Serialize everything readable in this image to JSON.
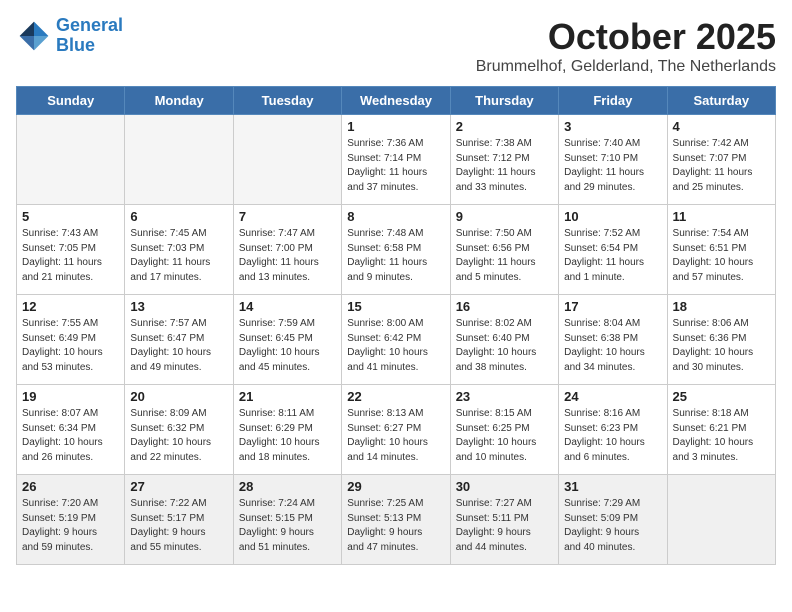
{
  "header": {
    "logo_line1": "General",
    "logo_line2": "Blue",
    "month_year": "October 2025",
    "location": "Brummelhof, Gelderland, The Netherlands"
  },
  "weekdays": [
    "Sunday",
    "Monday",
    "Tuesday",
    "Wednesday",
    "Thursday",
    "Friday",
    "Saturday"
  ],
  "weeks": [
    [
      {
        "day": "",
        "info": ""
      },
      {
        "day": "",
        "info": ""
      },
      {
        "day": "",
        "info": ""
      },
      {
        "day": "1",
        "info": "Sunrise: 7:36 AM\nSunset: 7:14 PM\nDaylight: 11 hours\nand 37 minutes."
      },
      {
        "day": "2",
        "info": "Sunrise: 7:38 AM\nSunset: 7:12 PM\nDaylight: 11 hours\nand 33 minutes."
      },
      {
        "day": "3",
        "info": "Sunrise: 7:40 AM\nSunset: 7:10 PM\nDaylight: 11 hours\nand 29 minutes."
      },
      {
        "day": "4",
        "info": "Sunrise: 7:42 AM\nSunset: 7:07 PM\nDaylight: 11 hours\nand 25 minutes."
      }
    ],
    [
      {
        "day": "5",
        "info": "Sunrise: 7:43 AM\nSunset: 7:05 PM\nDaylight: 11 hours\nand 21 minutes."
      },
      {
        "day": "6",
        "info": "Sunrise: 7:45 AM\nSunset: 7:03 PM\nDaylight: 11 hours\nand 17 minutes."
      },
      {
        "day": "7",
        "info": "Sunrise: 7:47 AM\nSunset: 7:00 PM\nDaylight: 11 hours\nand 13 minutes."
      },
      {
        "day": "8",
        "info": "Sunrise: 7:48 AM\nSunset: 6:58 PM\nDaylight: 11 hours\nand 9 minutes."
      },
      {
        "day": "9",
        "info": "Sunrise: 7:50 AM\nSunset: 6:56 PM\nDaylight: 11 hours\nand 5 minutes."
      },
      {
        "day": "10",
        "info": "Sunrise: 7:52 AM\nSunset: 6:54 PM\nDaylight: 11 hours\nand 1 minute."
      },
      {
        "day": "11",
        "info": "Sunrise: 7:54 AM\nSunset: 6:51 PM\nDaylight: 10 hours\nand 57 minutes."
      }
    ],
    [
      {
        "day": "12",
        "info": "Sunrise: 7:55 AM\nSunset: 6:49 PM\nDaylight: 10 hours\nand 53 minutes."
      },
      {
        "day": "13",
        "info": "Sunrise: 7:57 AM\nSunset: 6:47 PM\nDaylight: 10 hours\nand 49 minutes."
      },
      {
        "day": "14",
        "info": "Sunrise: 7:59 AM\nSunset: 6:45 PM\nDaylight: 10 hours\nand 45 minutes."
      },
      {
        "day": "15",
        "info": "Sunrise: 8:00 AM\nSunset: 6:42 PM\nDaylight: 10 hours\nand 41 minutes."
      },
      {
        "day": "16",
        "info": "Sunrise: 8:02 AM\nSunset: 6:40 PM\nDaylight: 10 hours\nand 38 minutes."
      },
      {
        "day": "17",
        "info": "Sunrise: 8:04 AM\nSunset: 6:38 PM\nDaylight: 10 hours\nand 34 minutes."
      },
      {
        "day": "18",
        "info": "Sunrise: 8:06 AM\nSunset: 6:36 PM\nDaylight: 10 hours\nand 30 minutes."
      }
    ],
    [
      {
        "day": "19",
        "info": "Sunrise: 8:07 AM\nSunset: 6:34 PM\nDaylight: 10 hours\nand 26 minutes."
      },
      {
        "day": "20",
        "info": "Sunrise: 8:09 AM\nSunset: 6:32 PM\nDaylight: 10 hours\nand 22 minutes."
      },
      {
        "day": "21",
        "info": "Sunrise: 8:11 AM\nSunset: 6:29 PM\nDaylight: 10 hours\nand 18 minutes."
      },
      {
        "day": "22",
        "info": "Sunrise: 8:13 AM\nSunset: 6:27 PM\nDaylight: 10 hours\nand 14 minutes."
      },
      {
        "day": "23",
        "info": "Sunrise: 8:15 AM\nSunset: 6:25 PM\nDaylight: 10 hours\nand 10 minutes."
      },
      {
        "day": "24",
        "info": "Sunrise: 8:16 AM\nSunset: 6:23 PM\nDaylight: 10 hours\nand 6 minutes."
      },
      {
        "day": "25",
        "info": "Sunrise: 8:18 AM\nSunset: 6:21 PM\nDaylight: 10 hours\nand 3 minutes."
      }
    ],
    [
      {
        "day": "26",
        "info": "Sunrise: 7:20 AM\nSunset: 5:19 PM\nDaylight: 9 hours\nand 59 minutes."
      },
      {
        "day": "27",
        "info": "Sunrise: 7:22 AM\nSunset: 5:17 PM\nDaylight: 9 hours\nand 55 minutes."
      },
      {
        "day": "28",
        "info": "Sunrise: 7:24 AM\nSunset: 5:15 PM\nDaylight: 9 hours\nand 51 minutes."
      },
      {
        "day": "29",
        "info": "Sunrise: 7:25 AM\nSunset: 5:13 PM\nDaylight: 9 hours\nand 47 minutes."
      },
      {
        "day": "30",
        "info": "Sunrise: 7:27 AM\nSunset: 5:11 PM\nDaylight: 9 hours\nand 44 minutes."
      },
      {
        "day": "31",
        "info": "Sunrise: 7:29 AM\nSunset: 5:09 PM\nDaylight: 9 hours\nand 40 minutes."
      },
      {
        "day": "",
        "info": ""
      }
    ]
  ]
}
